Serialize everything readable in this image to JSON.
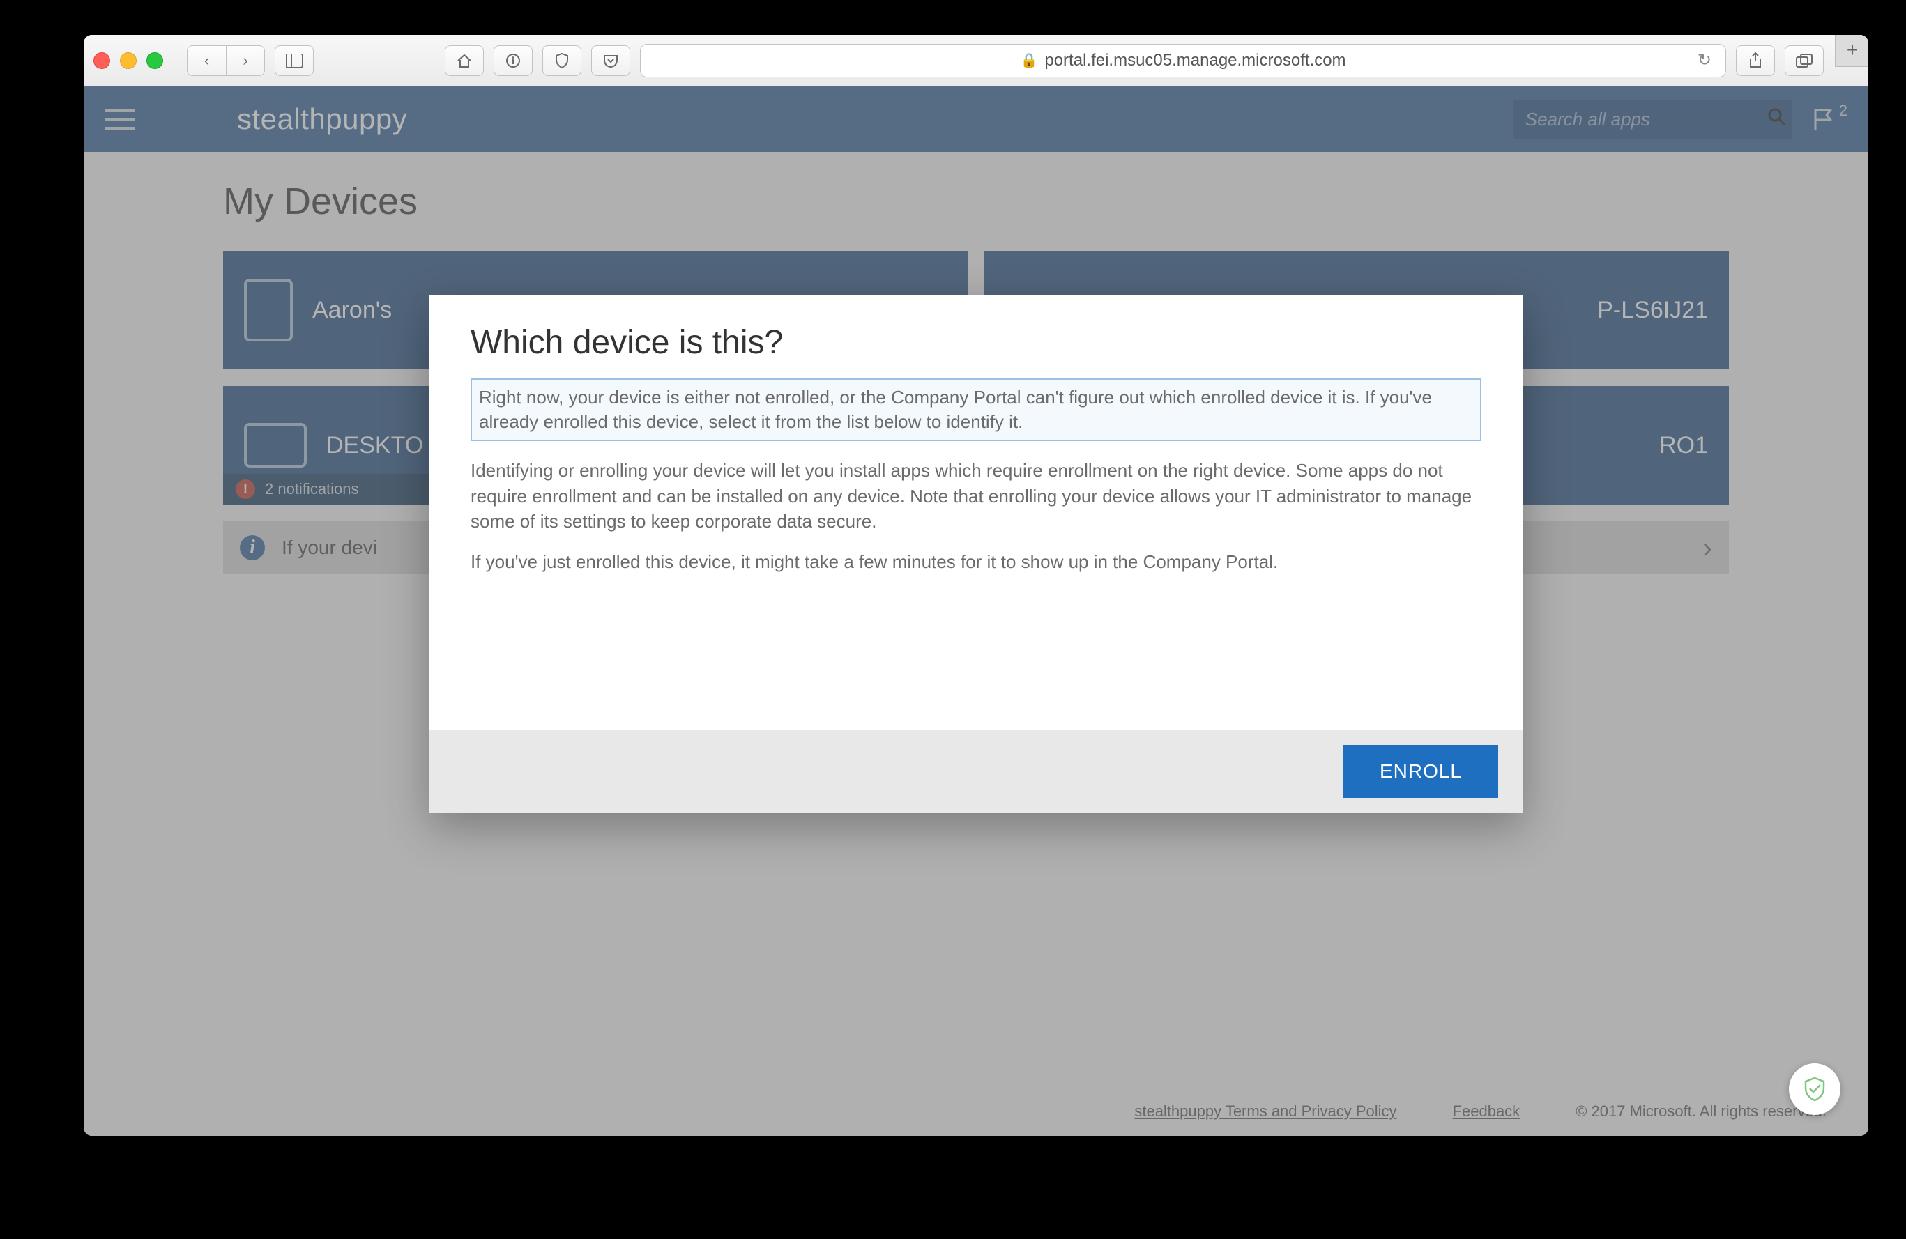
{
  "browser": {
    "url_host": "portal.fei.msuc05.manage.microsoft.com"
  },
  "header": {
    "brand": "stealthpuppy",
    "search_placeholder": "Search all apps",
    "notification_count": "2"
  },
  "page": {
    "title": "My Devices"
  },
  "devices": [
    {
      "label": "Aaron's",
      "type": "phone"
    },
    {
      "label": "P-LS6IJ21",
      "type": "phone"
    },
    {
      "label": "DESKTO",
      "type": "desktop",
      "notif_text": "2 notifications"
    },
    {
      "label": "RO1",
      "type": "desktop"
    }
  ],
  "info_bar": {
    "text": "If your devi"
  },
  "modal": {
    "title": "Which device is this?",
    "highlight": "Right now, your device is either not enrolled, or the Company Portal can't figure out which enrolled device it is. If you've already enrolled this device, select it from the list below to identify it.",
    "para1": "Identifying or enrolling your device will let you install apps which require enrollment on the right device. Some apps do not require enrollment and can be installed on any device. Note that enrolling your device allows your IT administrator to manage some of its settings to keep corporate data secure.",
    "para2": "If you've just enrolled this device, it might take a few minutes for it to show up in the Company Portal.",
    "enroll_label": "ENROLL"
  },
  "footer": {
    "policy": "stealthpuppy Terms and Privacy Policy",
    "feedback": "Feedback",
    "copyright": "© 2017 Microsoft. All rights reserved."
  }
}
